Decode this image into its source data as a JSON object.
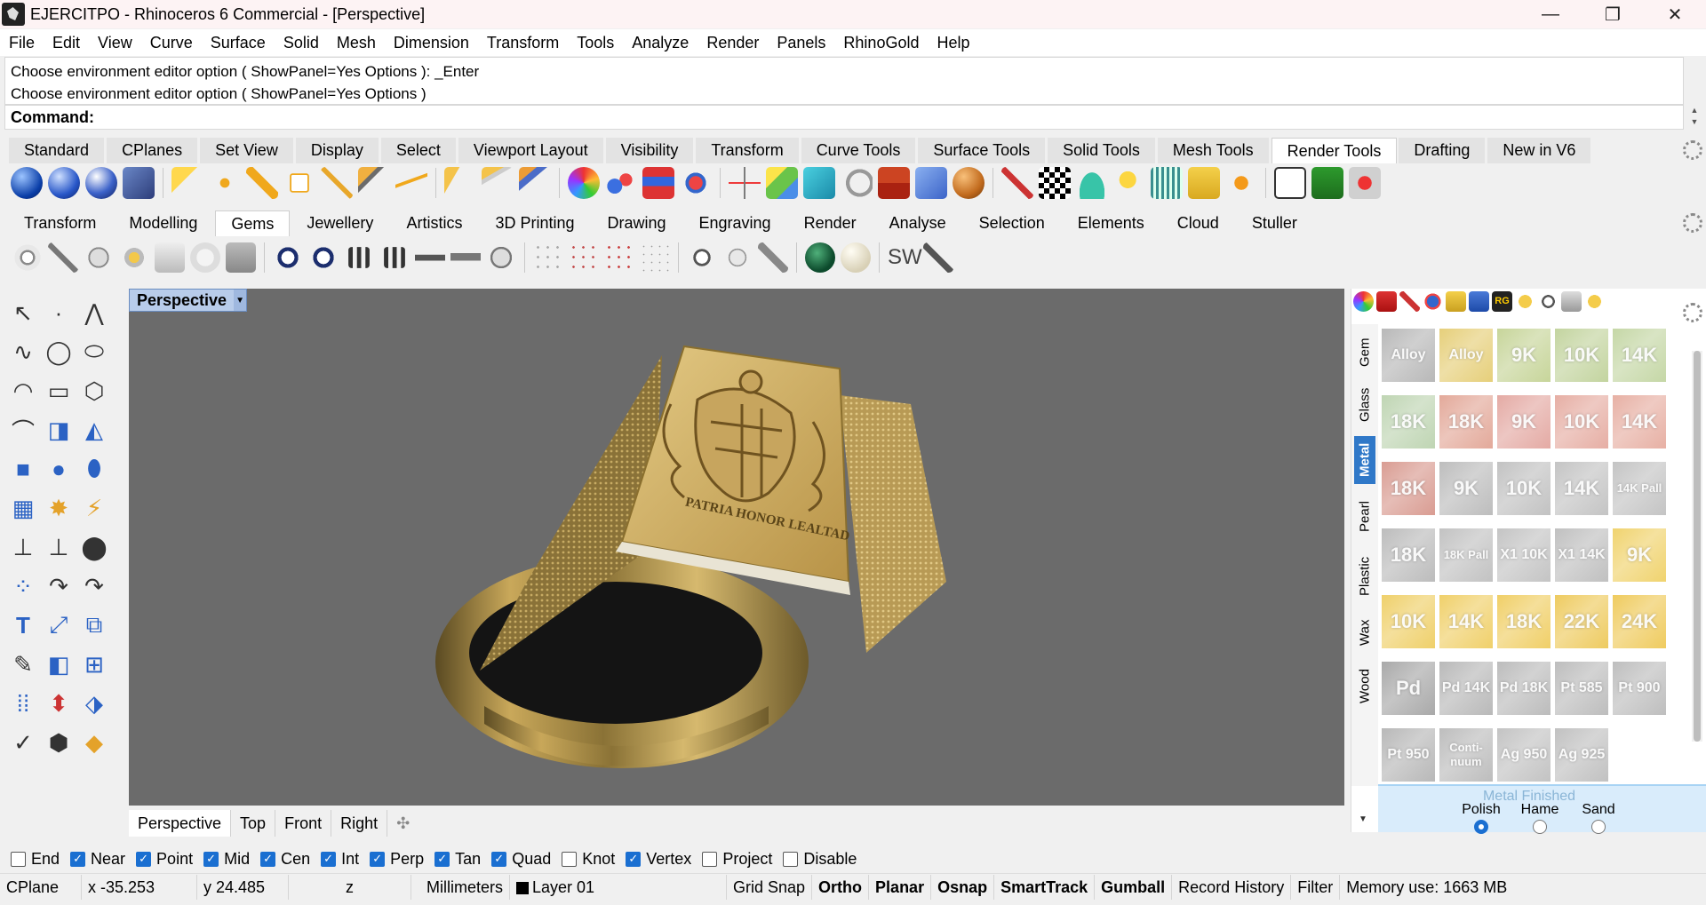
{
  "window": {
    "title": "EJERCITPO - Rhinoceros 6 Commercial - [Perspective]",
    "minimize": "—",
    "maximize": "❐",
    "close": "✕"
  },
  "menu": [
    "File",
    "Edit",
    "View",
    "Curve",
    "Surface",
    "Solid",
    "Mesh",
    "Dimension",
    "Transform",
    "Tools",
    "Analyze",
    "Render",
    "Panels",
    "RhinoGold",
    "Help"
  ],
  "history": [
    "Choose environment editor option ( ShowPanel=Yes  Options ): _Enter",
    "Choose environment editor option ( ShowPanel=Yes  Options )"
  ],
  "command_label": "Command:",
  "tabs1": [
    "Standard",
    "CPlanes",
    "Set View",
    "Display",
    "Select",
    "Viewport Layout",
    "Visibility",
    "Transform",
    "Curve Tools",
    "Surface Tools",
    "Solid Tools",
    "Mesh Tools",
    "Render Tools",
    "Drafting",
    "New in V6"
  ],
  "tabs1_active": "Render Tools",
  "tabs2": [
    "Transform",
    "Modelling",
    "Gems",
    "Jewellery",
    "Artistics",
    "3D Printing",
    "Drawing",
    "Engraving",
    "Render",
    "Analyse",
    "Selection",
    "Elements",
    "Cloud",
    "Stuller"
  ],
  "tabs2_active": "Gems",
  "toolbar2_text": "SW",
  "viewport": {
    "label": "Perspective",
    "tabs": [
      "Perspective",
      "Top",
      "Front",
      "Right"
    ],
    "add_tab": "✣"
  },
  "ring": {
    "engraving_text": "PATRIA HONOR LEALTAD"
  },
  "material_panel": {
    "side_tabs": [
      "Gem",
      "Glass",
      "Metal",
      "Pearl",
      "Plastic",
      "Wax",
      "Wood"
    ],
    "active_tab": "Metal",
    "swatches": [
      {
        "label": "Alloy",
        "color": "#b8b8b8"
      },
      {
        "label": "Alloy",
        "color": "#e6cf7a"
      },
      {
        "label": "9K",
        "color": "#c7d59a"
      },
      {
        "label": "10K",
        "color": "#c3d49f"
      },
      {
        "label": "14K",
        "color": "#c5d7a6"
      },
      {
        "label": "18K",
        "color": "#bfd5b3"
      },
      {
        "label": "18K",
        "color": "#e3a99a"
      },
      {
        "label": "9K",
        "color": "#e4aaa4"
      },
      {
        "label": "10K",
        "color": "#e6aea4"
      },
      {
        "label": "14K",
        "color": "#e7b0a4"
      },
      {
        "label": "18K",
        "color": "#d99c92"
      },
      {
        "label": "9K",
        "color": "#bdbdbd"
      },
      {
        "label": "10K",
        "color": "#c2c2c2"
      },
      {
        "label": "14K",
        "color": "#c4c4c4"
      },
      {
        "label": "14K Pall",
        "color": "#c4c4c4"
      },
      {
        "label": "18K",
        "color": "#bcbcbc"
      },
      {
        "label": "18K Pall",
        "color": "#c2c2c2"
      },
      {
        "label": "X1 10K",
        "color": "#c4c4c4"
      },
      {
        "label": "X1 14K",
        "color": "#c0c0c0"
      },
      {
        "label": "9K",
        "color": "#f0d36e"
      },
      {
        "label": "10K",
        "color": "#efd06a"
      },
      {
        "label": "14K",
        "color": "#f0d06a"
      },
      {
        "label": "18K",
        "color": "#f0cf67"
      },
      {
        "label": "22K",
        "color": "#eecb60"
      },
      {
        "label": "24K",
        "color": "#efcb5e"
      },
      {
        "label": "Pd",
        "color": "#a9a9a9"
      },
      {
        "label": "Pd 14K",
        "color": "#b9b9b9"
      },
      {
        "label": "Pd 18K",
        "color": "#bcbcbc"
      },
      {
        "label": "Pt 585",
        "color": "#bdbdbd"
      },
      {
        "label": "Pt 900",
        "color": "#bebebe"
      },
      {
        "label": "Pt 950",
        "color": "#b8b8b8"
      },
      {
        "label": "Conti-nuum",
        "color": "#bdbdbd"
      },
      {
        "label": "Ag 950",
        "color": "#c3c3c3"
      },
      {
        "label": "Ag 925",
        "color": "#c1c1c1"
      }
    ],
    "finish_title": "Metal Finished",
    "finish_options": [
      "Polish",
      "Hame",
      "Sand"
    ],
    "finish_selected": "Polish"
  },
  "osnaps": [
    {
      "label": "End",
      "checked": false
    },
    {
      "label": "Near",
      "checked": true
    },
    {
      "label": "Point",
      "checked": true
    },
    {
      "label": "Mid",
      "checked": true
    },
    {
      "label": "Cen",
      "checked": true
    },
    {
      "label": "Int",
      "checked": true
    },
    {
      "label": "Perp",
      "checked": true
    },
    {
      "label": "Tan",
      "checked": true
    },
    {
      "label": "Quad",
      "checked": true
    },
    {
      "label": "Knot",
      "checked": false
    },
    {
      "label": "Vertex",
      "checked": true
    },
    {
      "label": "Project",
      "checked": false
    },
    {
      "label": "Disable",
      "checked": false
    }
  ],
  "status": {
    "cplane": "CPlane",
    "x": "x -35.253",
    "y": "y 24.485",
    "z": "z",
    "units": "Millimeters",
    "layer": "Layer 01",
    "toggles": [
      "Grid Snap",
      "Ortho",
      "Planar",
      "Osnap",
      "SmartTrack",
      "Gumball",
      "Record History",
      "Filter"
    ],
    "bold_toggles": [
      "Ortho",
      "Planar",
      "Osnap",
      "SmartTrack",
      "Gumball"
    ],
    "memory": "Memory use: 1663 MB"
  },
  "colors": {
    "accent": "#1a6fd1",
    "viewport_bg": "#6b6b6b",
    "gold": "#c9a85a"
  }
}
